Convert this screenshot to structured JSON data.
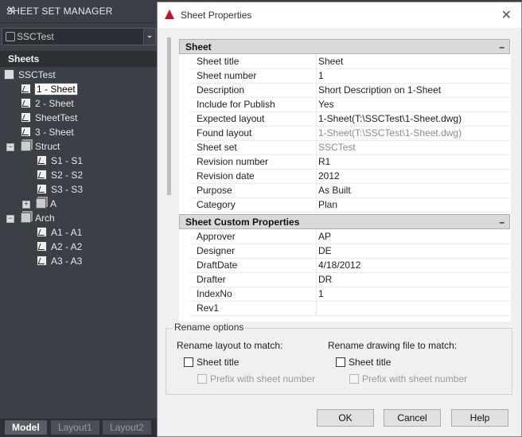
{
  "ssm": {
    "title": "SHEET SET MANAGER",
    "close": "✕",
    "combo_value": "SSCTest",
    "tab_label": "Sheets",
    "tree": {
      "root": "SSCTest",
      "sheets": [
        "1 - Sheet",
        "2 - Sheet",
        "SheetTest",
        "3 - Sheet"
      ],
      "struct": "Struct",
      "struct_items": [
        "S1 - S1",
        "S2 - S2",
        "S3 - S3"
      ],
      "struct_sub": "A",
      "arch": "Arch",
      "arch_items": [
        "A1 - A1",
        "A2 - A2",
        "A3 - A3"
      ]
    },
    "bottom_tabs": [
      "Model",
      "Layout1",
      "Layout2"
    ]
  },
  "dialog": {
    "title": "Sheet Properties",
    "close": "✕",
    "section_sheet": "Sheet",
    "section_custom": "Sheet Custom Properties",
    "collapse": "–",
    "sheet_props": [
      {
        "k": "Sheet title",
        "v": "Sheet"
      },
      {
        "k": "Sheet number",
        "v": "1"
      },
      {
        "k": "Description",
        "v": "Short Description on 1-Sheet"
      },
      {
        "k": "Include for Publish",
        "v": "Yes"
      },
      {
        "k": "Expected layout",
        "v": "1-Sheet(T:\\SSCTest\\1-Sheet.dwg)"
      },
      {
        "k": "Found layout",
        "v": "1-Sheet(T:\\SSCTest\\1-Sheet.dwg)"
      },
      {
        "k": "Sheet set",
        "v": "SSCTest"
      },
      {
        "k": "Revision number",
        "v": "R1"
      },
      {
        "k": "Revision date",
        "v": "2012"
      },
      {
        "k": "Purpose",
        "v": "As Built"
      },
      {
        "k": "Category",
        "v": "Plan"
      }
    ],
    "custom_props": [
      {
        "k": "Approver",
        "v": "AP"
      },
      {
        "k": "Designer",
        "v": "DE"
      },
      {
        "k": "DraftDate",
        "v": "4/18/2012"
      },
      {
        "k": "Drafter",
        "v": "DR"
      },
      {
        "k": "IndexNo",
        "v": "1"
      },
      {
        "k": "Rev1",
        "v": ""
      }
    ],
    "rename": {
      "legend": "Rename options",
      "layout_label": "Rename layout to match:",
      "file_label": "Rename drawing file to match:",
      "sheet_title": "Sheet title",
      "prefix": "Prefix with sheet number"
    },
    "buttons": {
      "ok": "OK",
      "cancel": "Cancel",
      "help": "Help"
    }
  }
}
